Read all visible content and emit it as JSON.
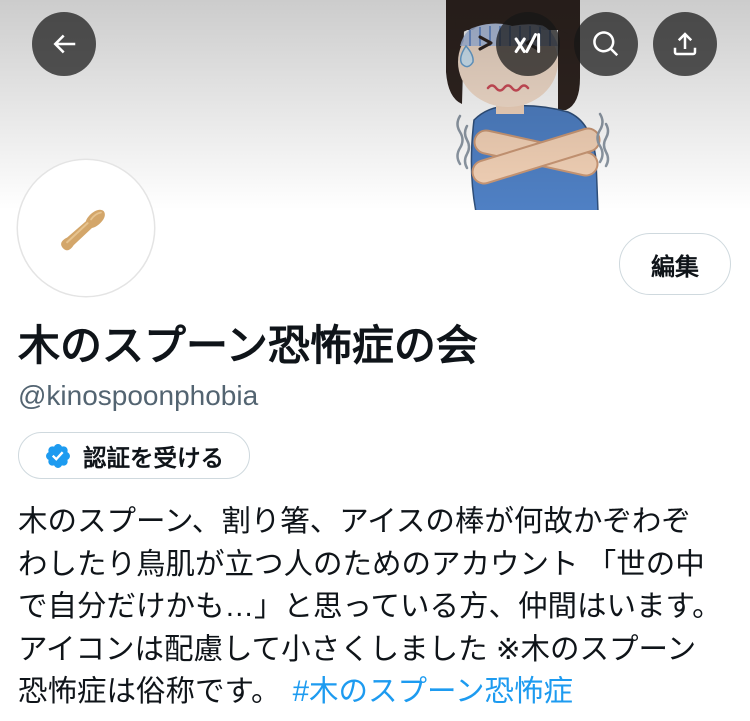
{
  "header": {
    "icons": {
      "back": "arrow-left-icon",
      "grok": "grok-icon",
      "search": "search-icon",
      "share": "share-icon"
    }
  },
  "profile": {
    "display_name": "木のスプーン恐怖症の会",
    "handle": "@kinospoonphobia",
    "edit_button_label": "編集",
    "verify_button_label": "認証を受ける",
    "bio": {
      "lines": [
        "木のスプーン、割り箸、アイスの棒が何故かぞわぞ",
        "わしたり鳥肌が立つ人のためのアカウント 「世の中",
        "で自分だけかも…」と思っている方、仲間はいます。",
        "アイコンは配慮して小さくしました ※木のスプーン",
        "恐怖症は俗称です。"
      ],
      "hashtag": "#木のスプーン恐怖症"
    }
  },
  "colors": {
    "text": "#0f1419",
    "secondary_text": "#536471",
    "link": "#1d9bf0",
    "verified_badge": "#1d9bf0",
    "button_border": "#cfd9de"
  }
}
